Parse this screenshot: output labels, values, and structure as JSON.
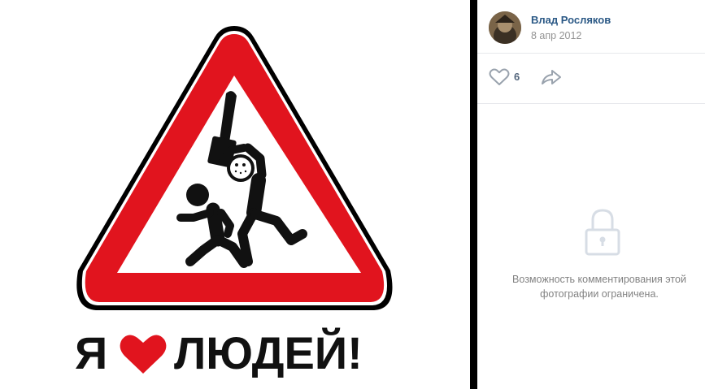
{
  "photo": {
    "slogan_left": "Я",
    "slogan_right": "ЛЮДЕЙ!",
    "colors": {
      "sign_red": "#e1141e",
      "heart_red": "#e1141e",
      "figure": "#111111"
    },
    "icons": [
      "warning-triangle-sign",
      "heart-icon",
      "stick-figures-icon"
    ]
  },
  "sidebar": {
    "author_name": "Влад Росляков",
    "post_date": "8 апр 2012",
    "likes_count": "6",
    "comments_restricted_text": "Возможность комментирования этой фотографии ограничена.",
    "icons": {
      "like": "heart-outline-icon",
      "share": "share-arrow-icon",
      "lock": "lock-icon"
    },
    "colors": {
      "link": "#2a5885",
      "muted": "#939393",
      "icon": "#99a2ad"
    }
  }
}
